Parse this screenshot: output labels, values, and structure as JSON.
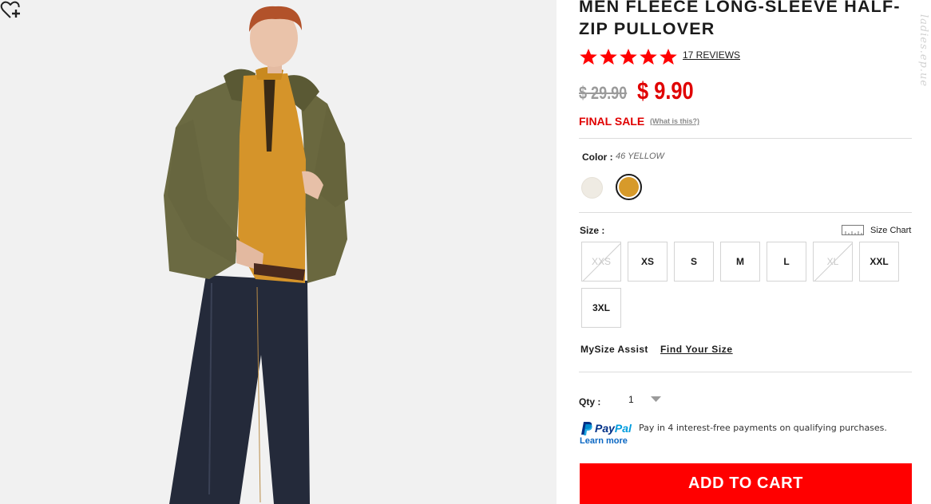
{
  "product": {
    "title": "MEN FLEECE LONG-SLEEVE HALF-ZIP PULLOVER",
    "rating_stars": 5,
    "reviews_label": "17 REVIEWS",
    "original_price": "$ 29.90",
    "sale_price": "$ 9.90",
    "final_sale_label": "FINAL SALE",
    "what_is_this_label": "(What is this?)"
  },
  "color": {
    "label": "Color :",
    "selected_value": "46 YELLOW",
    "swatches": [
      {
        "name": "off-white",
        "hex": "#efebe3",
        "selected": false
      },
      {
        "name": "yellow",
        "hex": "#d79a2a",
        "selected": true
      }
    ]
  },
  "size": {
    "label": "Size :",
    "chart_label": "Size Chart",
    "options": [
      {
        "label": "XXS",
        "available": false
      },
      {
        "label": "XS",
        "available": true
      },
      {
        "label": "S",
        "available": true
      },
      {
        "label": "M",
        "available": true
      },
      {
        "label": "L",
        "available": true
      },
      {
        "label": "XL",
        "available": false
      },
      {
        "label": "XXL",
        "available": true
      },
      {
        "label": "3XL",
        "available": true
      }
    ]
  },
  "mysize": {
    "label": "MySize Assist",
    "link_label": "Find Your Size"
  },
  "quantity": {
    "label": "Qty :",
    "value": "1"
  },
  "paypal": {
    "logo_text": "PayPal",
    "message": "Pay in 4 interest-free payments on qualifying purchases.",
    "learn_more_label": "Learn more"
  },
  "cart": {
    "button_label": "ADD TO CART"
  },
  "colors": {
    "accent_red": "#ff0000",
    "price_red": "#e00000",
    "paypal_blue": "#0a67c3"
  },
  "icons": {
    "wishlist": "heart-plus-icon",
    "size_chart": "ruler-icon",
    "qty_dropdown": "chevron-down-icon",
    "rating": "star-icon"
  }
}
